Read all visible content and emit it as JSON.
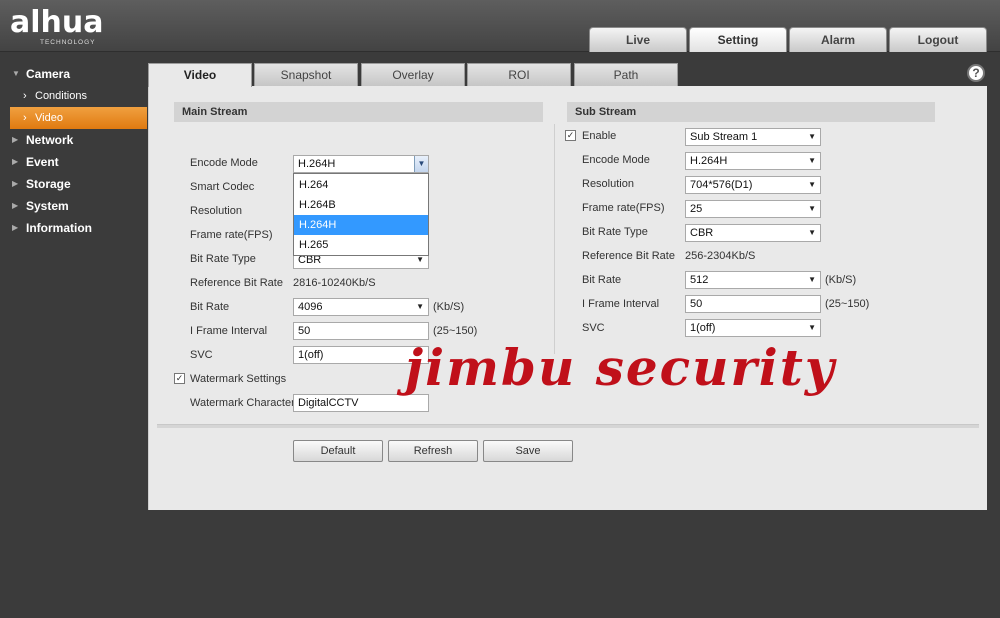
{
  "header": {
    "logo": "alhua",
    "logo_sub": "TECHNOLOGY",
    "nav": [
      "Live",
      "Setting",
      "Alarm",
      "Logout"
    ]
  },
  "sidebar": {
    "camera": "Camera",
    "conditions": "Conditions",
    "video": "Video",
    "network": "Network",
    "event": "Event",
    "storage": "Storage",
    "system": "System",
    "information": "Information"
  },
  "tabs": [
    "Video",
    "Snapshot",
    "Overlay",
    "ROI",
    "Path"
  ],
  "main_stream": {
    "title": "Main Stream",
    "encode_mode_label": "Encode Mode",
    "encode_mode": "H.264H",
    "smart_codec_label": "Smart Codec",
    "resolution_label": "Resolution",
    "frame_rate_label": "Frame rate(FPS)",
    "bit_rate_type_label": "Bit Rate Type",
    "bit_rate_type": "CBR",
    "ref_bit_rate_label": "Reference Bit Rate",
    "ref_bit_rate": "2816-10240Kb/S",
    "bit_rate_label": "Bit Rate",
    "bit_rate": "4096",
    "bit_rate_unit": "(Kb/S)",
    "iframe_label": "I Frame Interval",
    "iframe": "50",
    "iframe_range": "(25~150)",
    "svc_label": "SVC",
    "svc": "1(off)",
    "watermark_settings_label": "Watermark Settings",
    "watermark_checked": "✓",
    "watermark_char_label": "Watermark Character",
    "watermark_char": "DigitalCCTV",
    "encode_options": [
      "H.264",
      "H.264B",
      "H.264H",
      "H.265"
    ]
  },
  "sub_stream": {
    "title": "Sub Stream",
    "enable_label": "Enable",
    "enable_checked": "✓",
    "stream": "Sub Stream 1",
    "encode_mode_label": "Encode Mode",
    "encode_mode": "H.264H",
    "resolution_label": "Resolution",
    "resolution": "704*576(D1)",
    "frame_rate_label": "Frame rate(FPS)",
    "frame_rate": "25",
    "bit_rate_type_label": "Bit Rate Type",
    "bit_rate_type": "CBR",
    "ref_bit_rate_label": "Reference Bit Rate",
    "ref_bit_rate": "256-2304Kb/S",
    "bit_rate_label": "Bit Rate",
    "bit_rate": "512",
    "bit_rate_unit": "(Kb/S)",
    "iframe_label": "I Frame Interval",
    "iframe": "50",
    "iframe_range": "(25~150)",
    "svc_label": "SVC",
    "svc": "1(off)"
  },
  "buttons": {
    "default": "Default",
    "refresh": "Refresh",
    "save": "Save"
  },
  "watermark_overlay": "jimbu security",
  "icons": {
    "help": "?",
    "dropdown_arrow": "▼",
    "expand_arrow": "▼",
    "collapsed_arrow": "▶",
    "chevron": "›"
  }
}
